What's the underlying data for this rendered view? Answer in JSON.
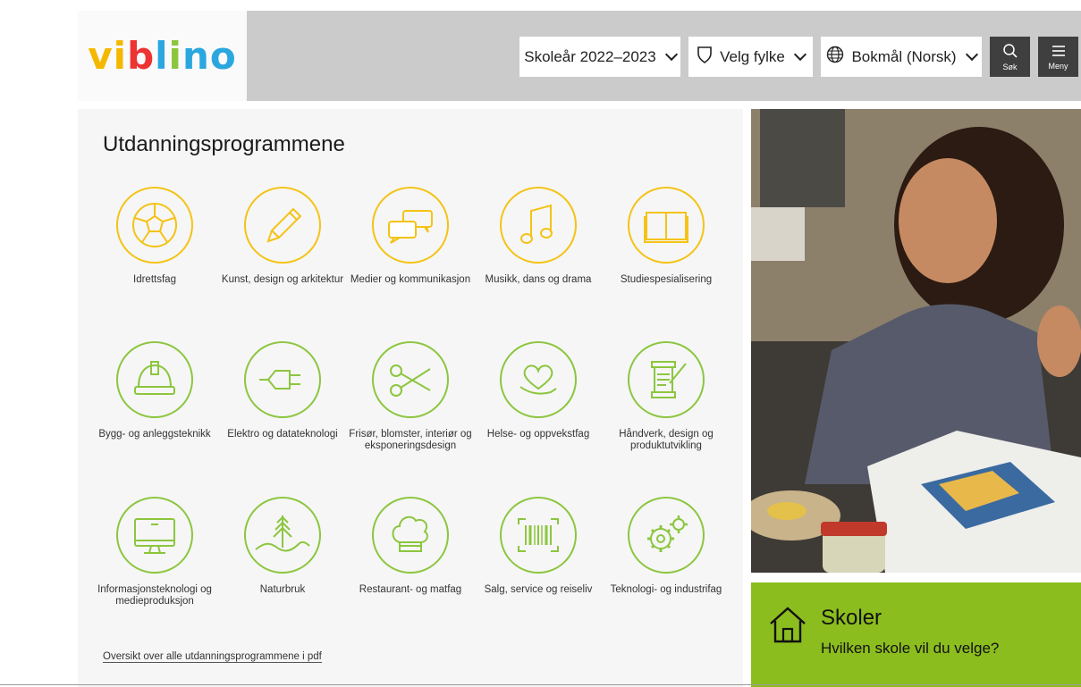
{
  "logo": {
    "part1": "vi",
    "part2": "b",
    "part3": "l",
    "part4": "i",
    "part5": "no"
  },
  "header": {
    "school_year": "Skoleår 2022–2023",
    "county": "Velg fylke",
    "language": "Bokmål (Norsk)",
    "search_label": "Søk",
    "menu_label": "Meny"
  },
  "main": {
    "title": "Utdanningsprogrammene",
    "programs": [
      {
        "label": "Idrettsfag",
        "icon": "football-icon",
        "color": "#f4c316"
      },
      {
        "label": "Kunst, design og arkitektur",
        "icon": "pencil-icon",
        "color": "#f4c316"
      },
      {
        "label": "Medier og kommunikasjon",
        "icon": "speech-bubbles-icon",
        "color": "#f4c316"
      },
      {
        "label": "Musikk, dans og drama",
        "icon": "music-note-icon",
        "color": "#f4c316"
      },
      {
        "label": "Studiespesialisering",
        "icon": "book-icon",
        "color": "#f4c316"
      },
      {
        "label": "Bygg- og anleggsteknikk",
        "icon": "hard-hat-icon",
        "color": "#8cc63f"
      },
      {
        "label": "Elektro og datateknologi",
        "icon": "plug-icon",
        "color": "#8cc63f"
      },
      {
        "label": "Frisør, blomster, interiør og eksponeringsdesign",
        "icon": "scissors-icon",
        "color": "#8cc63f"
      },
      {
        "label": "Helse- og oppvekstfag",
        "icon": "heart-hand-icon",
        "color": "#8cc63f"
      },
      {
        "label": "Håndverk, design og produktutvikling",
        "icon": "thread-spool-icon",
        "color": "#8cc63f"
      },
      {
        "label": "Informasjonsteknologi og medieproduksjon",
        "icon": "monitor-icon",
        "color": "#8cc63f"
      },
      {
        "label": "Naturbruk",
        "icon": "tree-icon",
        "color": "#8cc63f"
      },
      {
        "label": "Restaurant- og matfag",
        "icon": "chef-hat-icon",
        "color": "#8cc63f"
      },
      {
        "label": "Salg, service og reiseliv",
        "icon": "barcode-icon",
        "color": "#8cc63f"
      },
      {
        "label": "Teknologi- og industrifag",
        "icon": "gears-icon",
        "color": "#8cc63f"
      }
    ],
    "pdf_link": "Oversikt over alle utdanningsprogrammene i pdf"
  },
  "schools_card": {
    "title": "Skoler",
    "subtitle": "Hvilken skole vil du velge?",
    "icon": "house-icon"
  }
}
